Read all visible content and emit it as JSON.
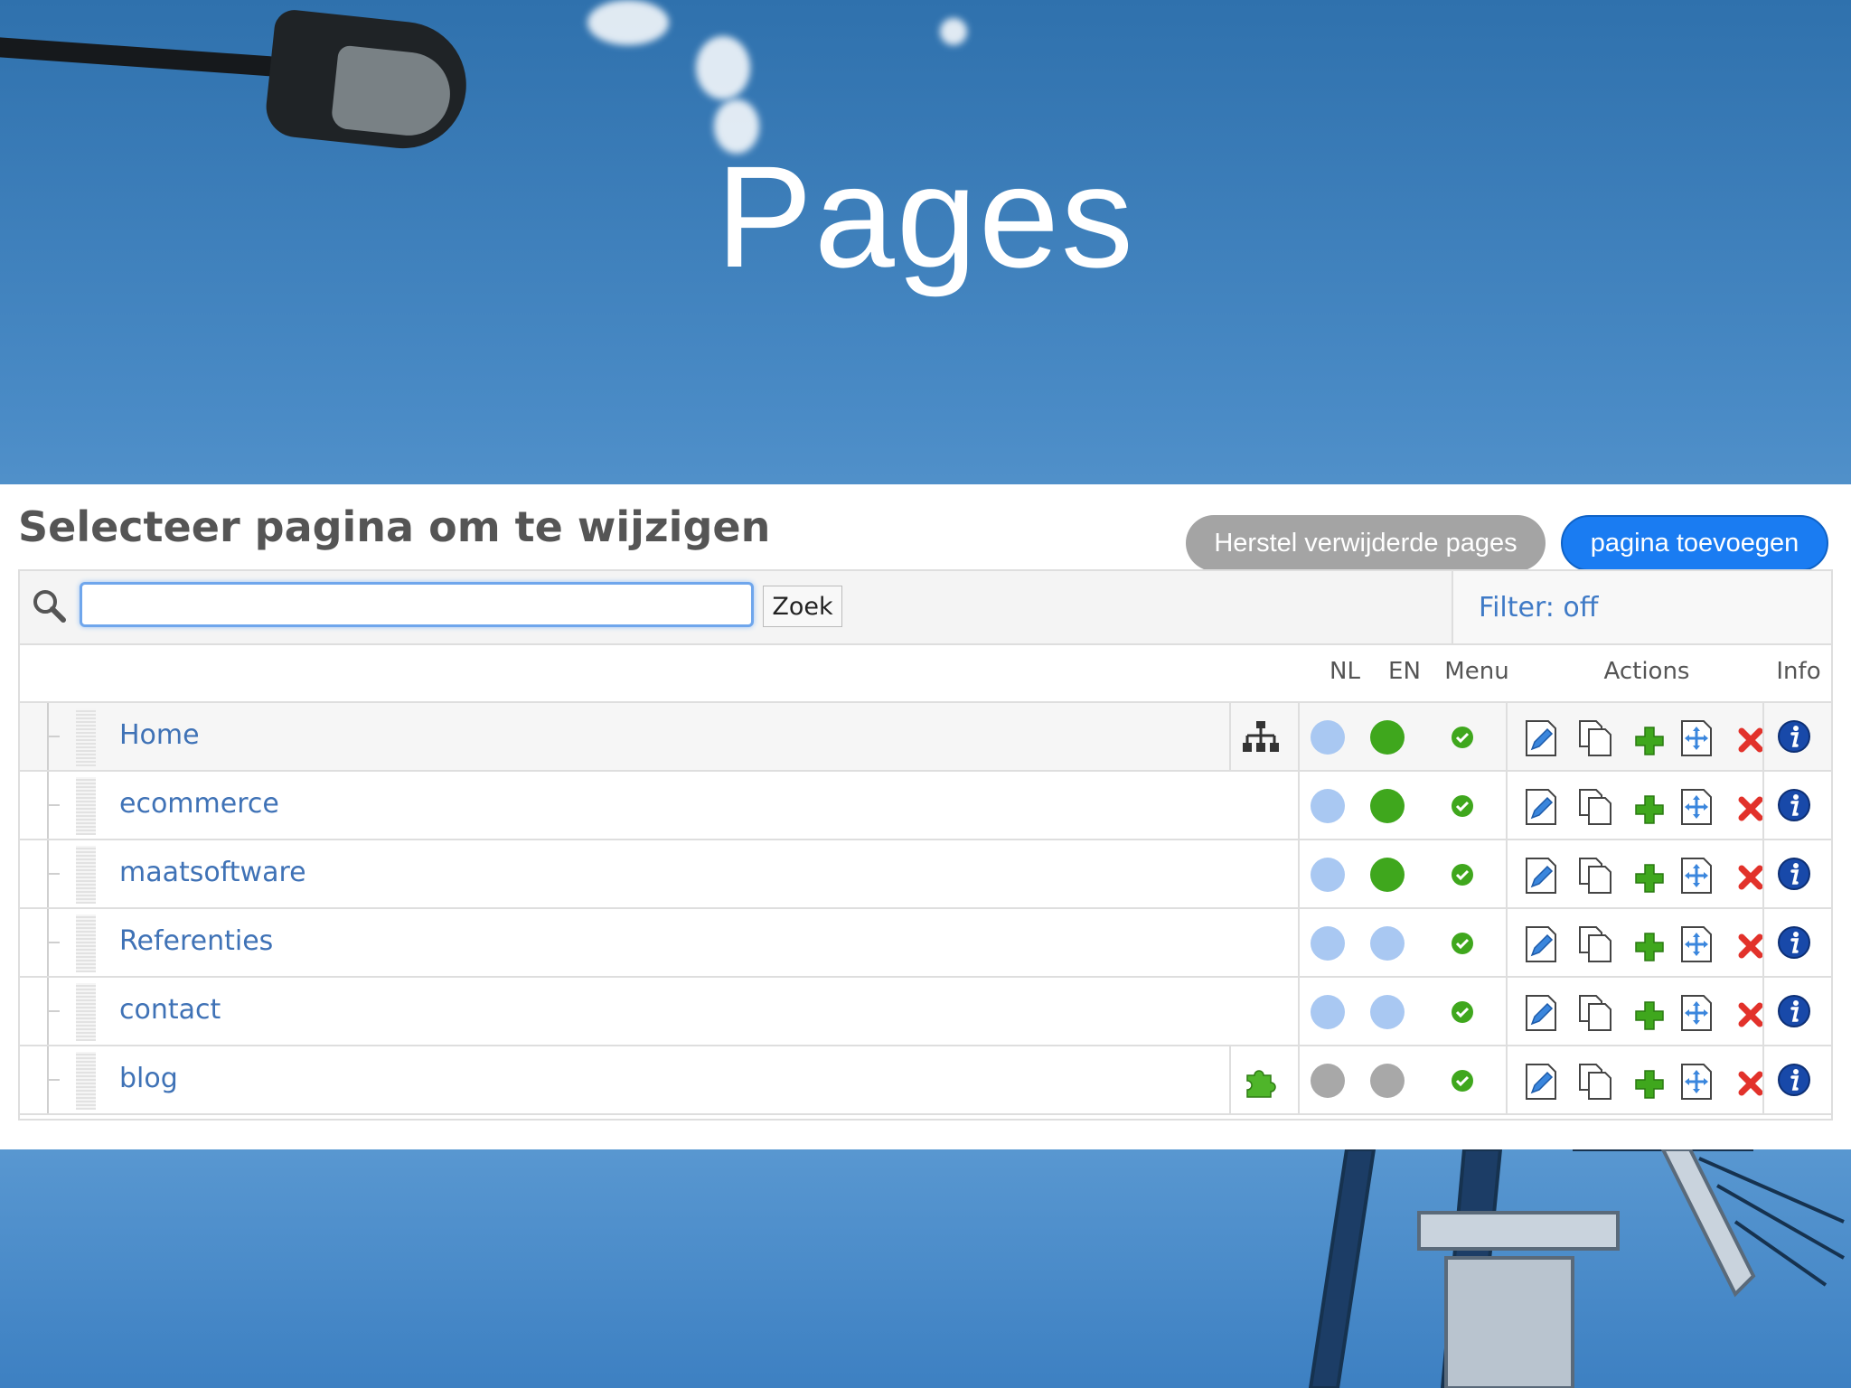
{
  "slide": {
    "title": "Pages"
  },
  "panel": {
    "title": "Selecteer pagina om te wijzigen",
    "restore_button": "Herstel verwijderde pages",
    "add_button": "pagina toevoegen"
  },
  "search": {
    "value": "",
    "button": "Zoek",
    "filter": "Filter: off"
  },
  "columns": {
    "nl": "NL",
    "en": "EN",
    "menu": "Menu",
    "actions": "Actions",
    "info": "Info"
  },
  "rows": [
    {
      "name": "Home",
      "marker": "sitemap-icon",
      "nl": "light-blue",
      "en": "green",
      "menu": "check"
    },
    {
      "name": "ecommerce",
      "marker": "",
      "nl": "light-blue",
      "en": "green",
      "menu": "check"
    },
    {
      "name": "maatsoftware",
      "marker": "",
      "nl": "light-blue",
      "en": "green",
      "menu": "check"
    },
    {
      "name": "Referenties",
      "marker": "",
      "nl": "light-blue",
      "en": "light-blue",
      "menu": "check"
    },
    {
      "name": "contact",
      "marker": "",
      "nl": "light-blue",
      "en": "light-blue",
      "menu": "check"
    },
    {
      "name": "blog",
      "marker": "puzzle-icon",
      "nl": "grey",
      "en": "grey",
      "menu": "check"
    }
  ],
  "action_icons": [
    "edit-icon",
    "copy-icon",
    "add-child-icon",
    "move-icon",
    "delete-icon"
  ],
  "colors": {
    "accent": "#1a7cf2",
    "link": "#3f72b6",
    "status_green": "#3fa71d",
    "status_light": "#a9c8f2",
    "status_grey": "#a8a8a8",
    "delete_red": "#e2322b"
  }
}
